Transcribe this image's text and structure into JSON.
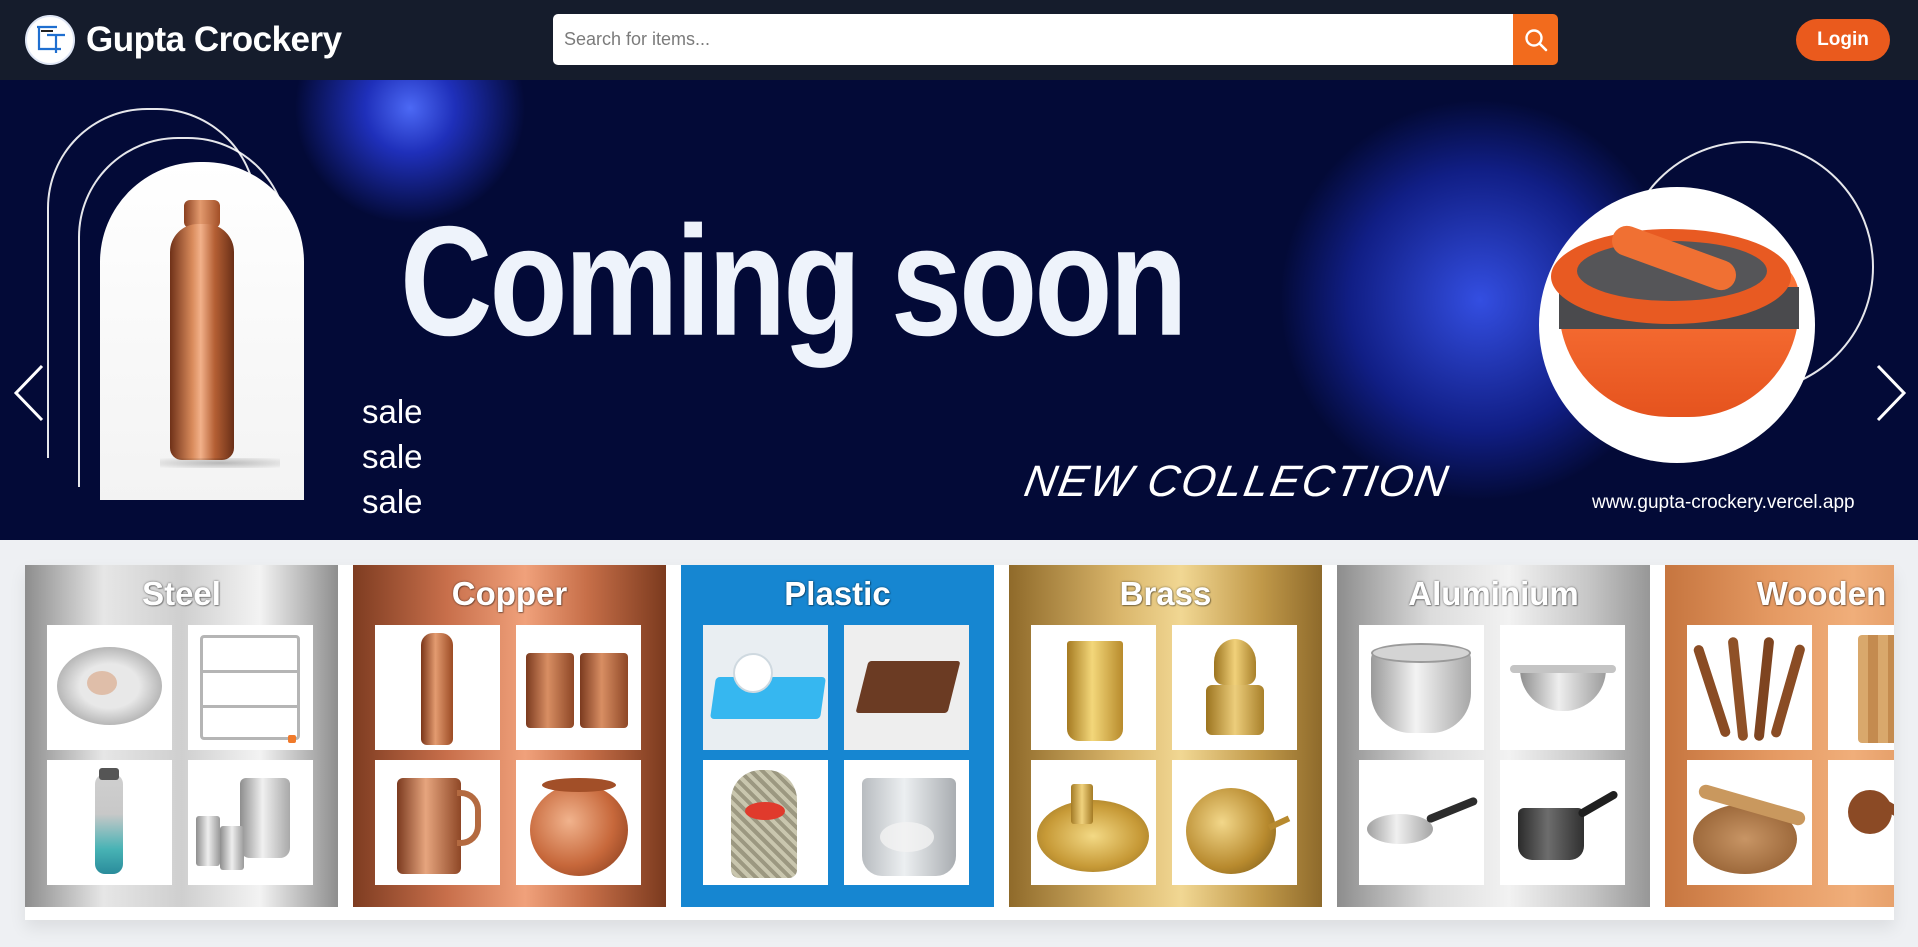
{
  "header": {
    "brand": "Gupta Crockery",
    "search_placeholder": "Search for items...",
    "login_label": "Login"
  },
  "banner": {
    "title": "Coming soon",
    "sale_lines": [
      "sale",
      "sale",
      "sale"
    ],
    "tagline": "NEW COLLECTION",
    "url": "www.gupta-crockery.vercel.app",
    "slides_total": 3,
    "active_slide": 2
  },
  "categories": [
    {
      "name": "Steel",
      "items": [
        "plate",
        "dish rack",
        "water bottle",
        "jug and glasses"
      ]
    },
    {
      "name": "Copper",
      "items": [
        "bottle",
        "tumblers",
        "jug",
        "pot"
      ]
    },
    {
      "name": "Plastic",
      "items": [
        "dish drainer",
        "basket",
        "dustbin",
        "bucket"
      ]
    },
    {
      "name": "Brass",
      "items": [
        "tumbler",
        "lamp",
        "thali set",
        "kalash"
      ]
    },
    {
      "name": "Aluminium",
      "items": [
        "patila",
        "kadai",
        "frying pan",
        "saucepan"
      ]
    },
    {
      "name": "Wooden",
      "items": [
        "spatulas",
        "chopping board",
        "chakla belan",
        "ladle"
      ]
    }
  ],
  "colors": {
    "header_bg": "#151c2c",
    "accent": "#f26b1d",
    "banner_bg": "#030a37"
  }
}
